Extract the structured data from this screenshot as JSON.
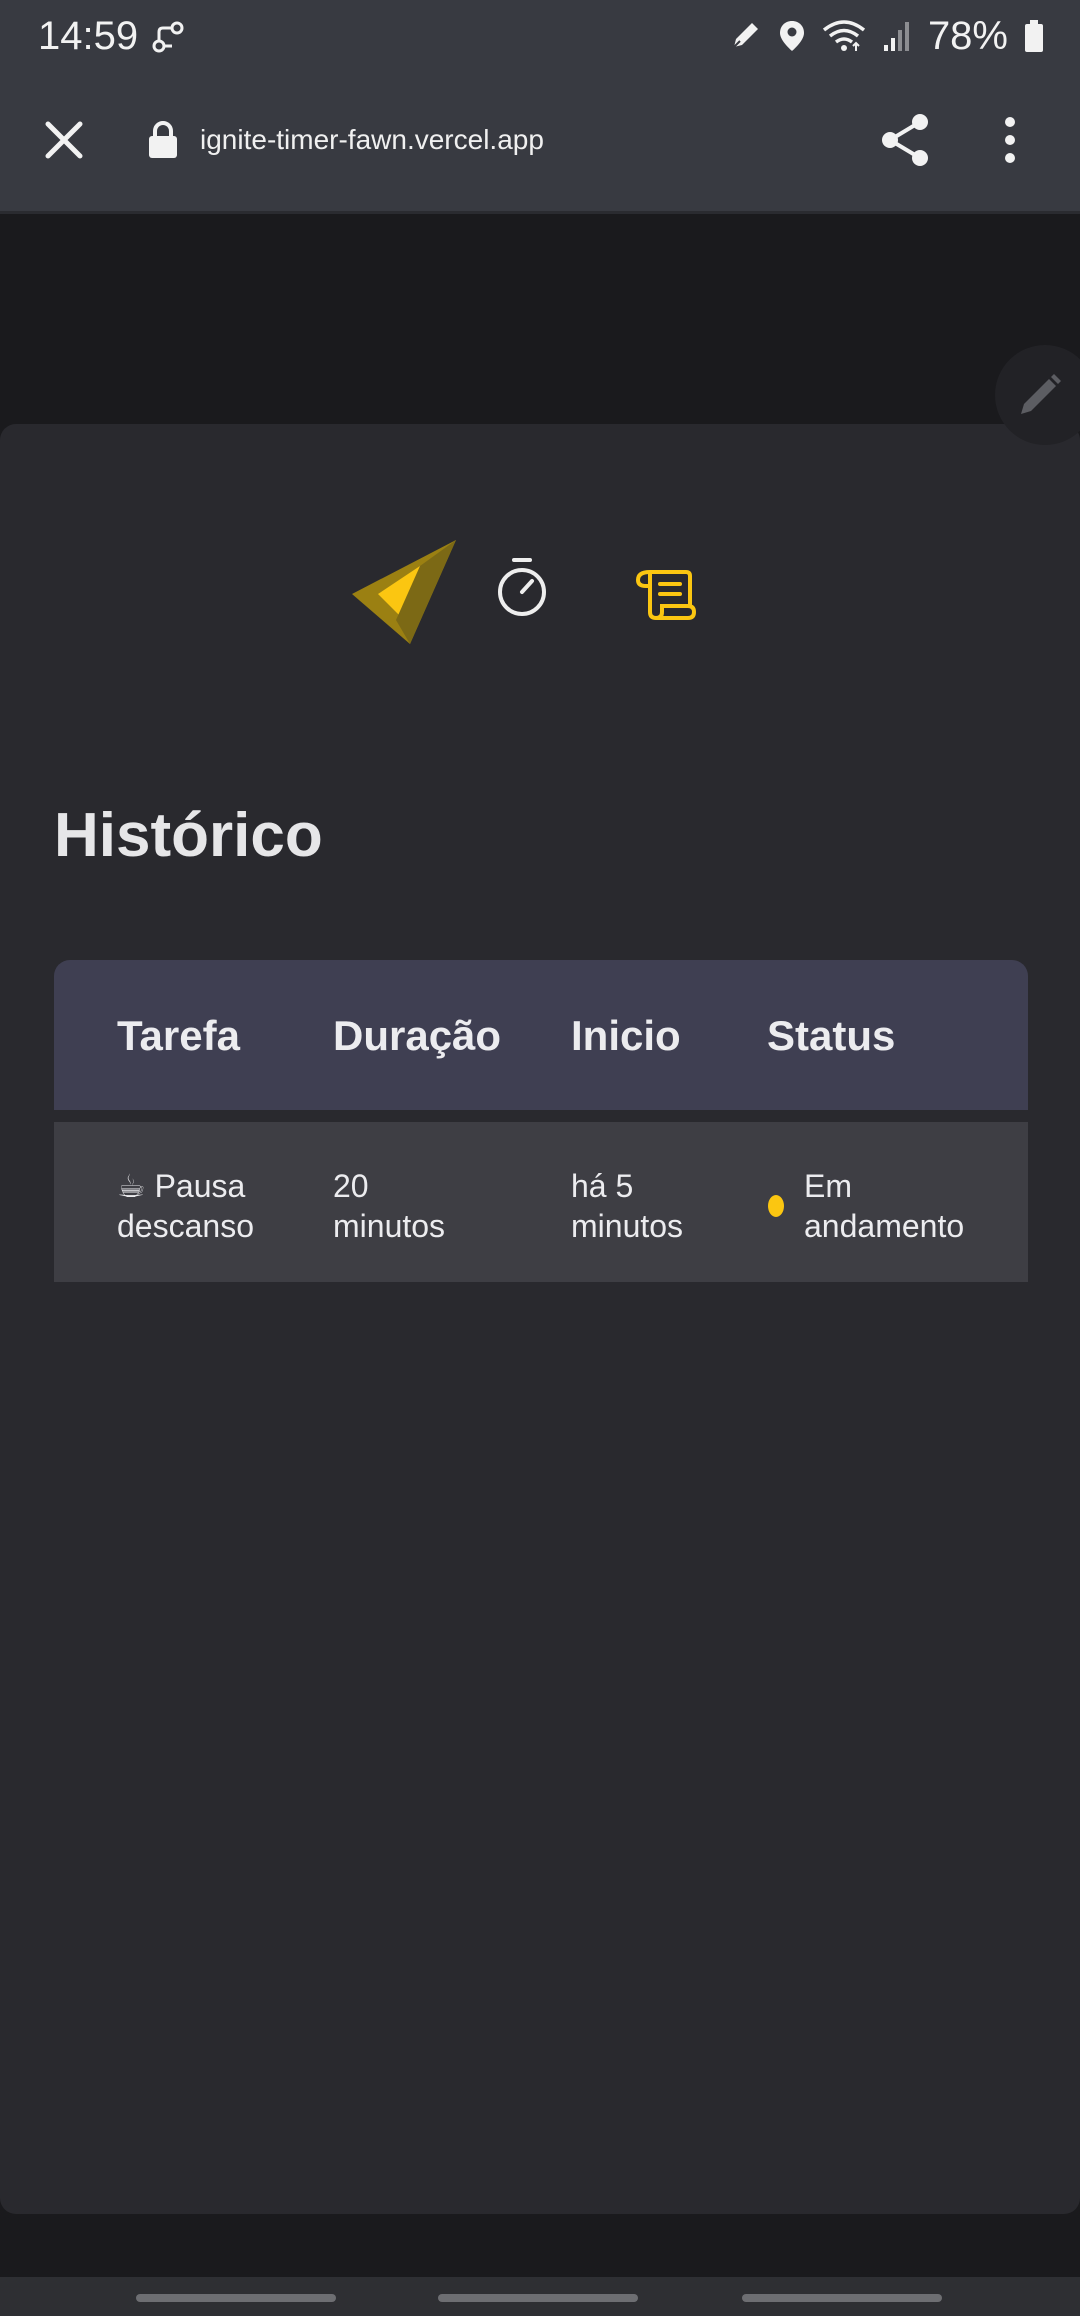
{
  "status_bar": {
    "time": "14:59",
    "battery": "78%",
    "icons": [
      "link-icon",
      "pen-icon",
      "location-icon",
      "wifi-icon",
      "signal-icon",
      "battery-icon"
    ]
  },
  "browser": {
    "url": "ignite-timer-fawn.vercel.app",
    "icons": [
      "close-icon",
      "lock-icon",
      "share-icon",
      "more-vertical-icon"
    ]
  },
  "app": {
    "title": "Histórico",
    "nav_icons": [
      "logo-icon",
      "timer-icon",
      "history-scroll-icon"
    ],
    "accent_color": "#fbc611",
    "table": {
      "headers": [
        "Tarefa",
        "Duração",
        "Inicio",
        "Status"
      ],
      "rows": [
        {
          "task_line1": "☕ Pausa",
          "task_line2": "descanso",
          "duration_line1": "20",
          "duration_line2": "minutos",
          "start_line1": "há 5",
          "start_line2": "minutos",
          "status_line1": "Em",
          "status_line2": "andamento",
          "status_color": "#fbc611"
        }
      ]
    }
  }
}
